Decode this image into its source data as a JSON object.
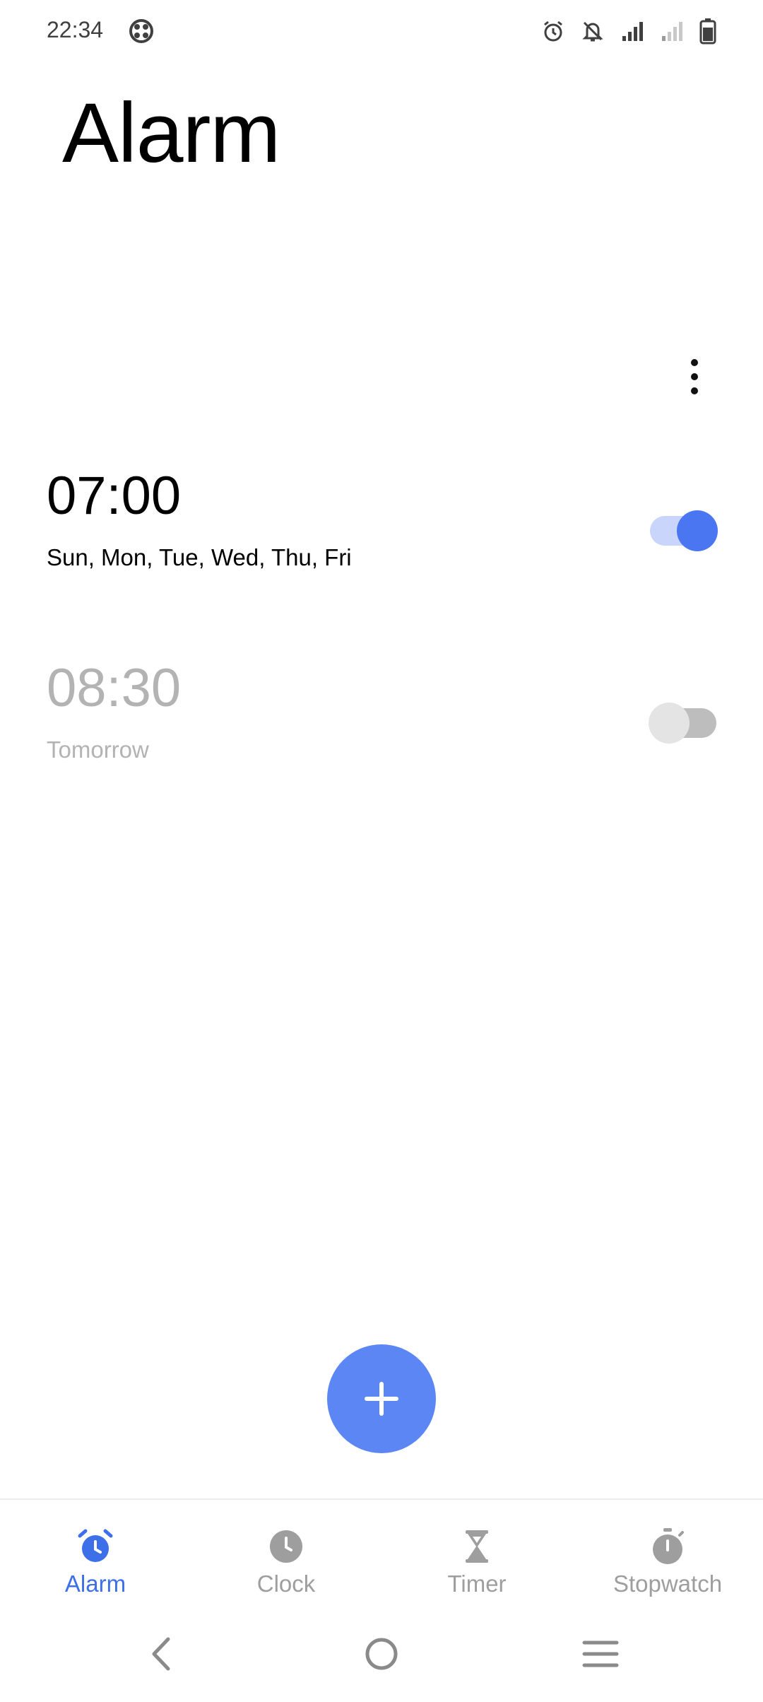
{
  "status_bar": {
    "time": "22:34",
    "icons": [
      "app-notification-icon",
      "alarm-icon",
      "bell-off-icon",
      "signal-icon",
      "signal-weak-icon",
      "battery-icon"
    ]
  },
  "page": {
    "title": "Alarm"
  },
  "alarms": [
    {
      "time": "07:00",
      "repeat": "Sun, Mon, Tue, Wed, Thu, Fri",
      "enabled": true
    },
    {
      "time": "08:30",
      "repeat": "Tomorrow",
      "enabled": false
    }
  ],
  "bottom_nav": {
    "items": [
      {
        "label": "Alarm",
        "icon": "alarm-clock-icon",
        "active": true
      },
      {
        "label": "Clock",
        "icon": "clock-icon",
        "active": false
      },
      {
        "label": "Timer",
        "icon": "hourglass-icon",
        "active": false
      },
      {
        "label": "Stopwatch",
        "icon": "stopwatch-icon",
        "active": false
      }
    ]
  },
  "colors": {
    "accent": "#4a76f2",
    "fab": "#5b86f4",
    "inactive": "#9e9e9e",
    "disabled_text": "#b3b3b3"
  }
}
